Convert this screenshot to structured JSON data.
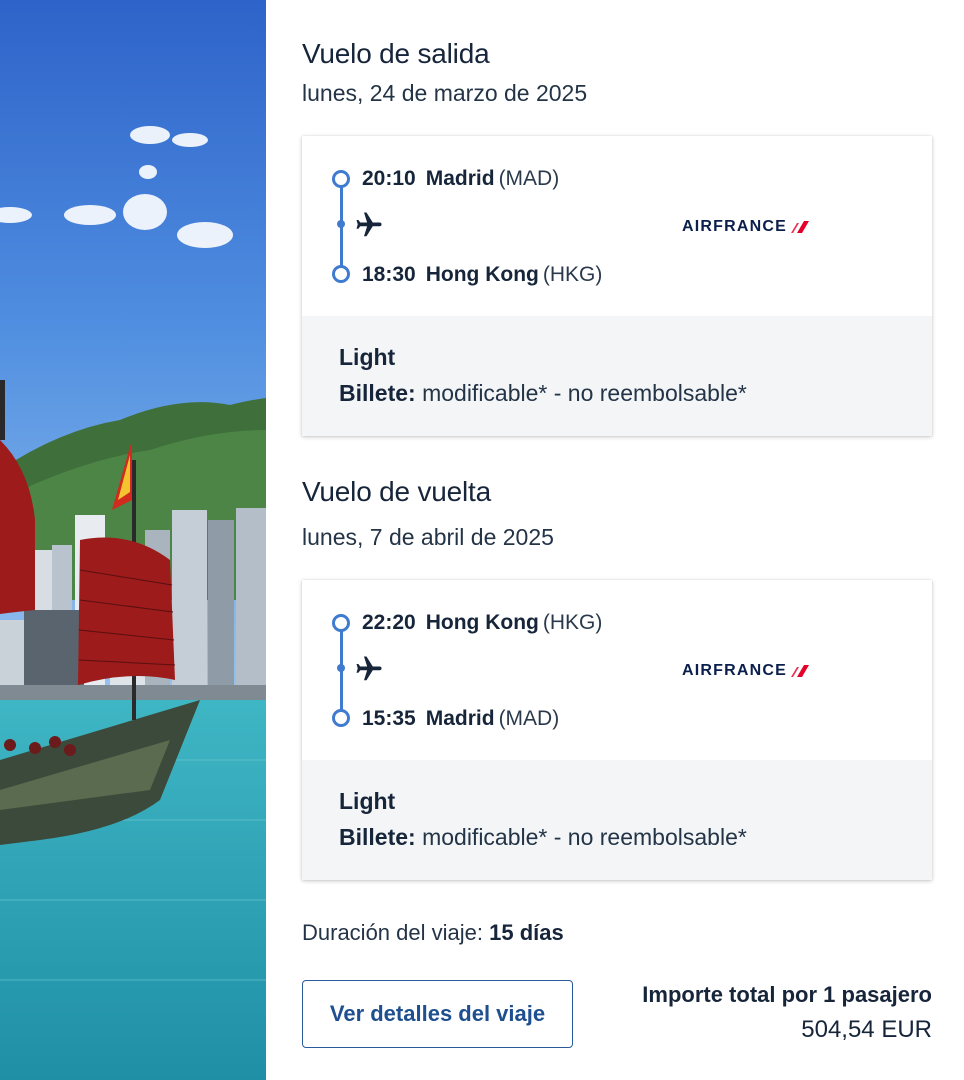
{
  "outbound": {
    "title": "Vuelo de salida",
    "date": "lunes, 24 de marzo de 2025",
    "departure": {
      "time": "20:10",
      "city": "Madrid",
      "code": "(MAD)"
    },
    "arrival": {
      "time": "18:30",
      "city": "Hong Kong",
      "code": "(HKG)"
    },
    "airline": "AIRFRANCE",
    "fare_name": "Light",
    "ticket_label": "Billete:",
    "ticket_conditions": "modificable* - no reembolsable*"
  },
  "return": {
    "title": "Vuelo de vuelta",
    "date": "lunes, 7 de abril de 2025",
    "departure": {
      "time": "22:20",
      "city": "Hong Kong",
      "code": "(HKG)"
    },
    "arrival": {
      "time": "15:35",
      "city": "Madrid",
      "code": "(MAD)"
    },
    "airline": "AIRFRANCE",
    "fare_name": "Light",
    "ticket_label": "Billete:",
    "ticket_conditions": "modificable* - no reembolsable*"
  },
  "summary": {
    "duration_label": "Duración del viaje:",
    "duration_value": "15 días",
    "details_button": "Ver detalles del viaje",
    "total_label": "Importe total por 1 pasajero",
    "total_value": "504,54 EUR"
  },
  "colors": {
    "accent": "#3f7bcf",
    "button": "#1e4f8f",
    "text": "#17253a",
    "fare_bg": "#f3f5f7",
    "airline_navy": "#0b1f4d",
    "airline_red": "#e4002b"
  },
  "icons": {
    "plane": "plane-icon",
    "airline_logo": "air-france-logo"
  }
}
